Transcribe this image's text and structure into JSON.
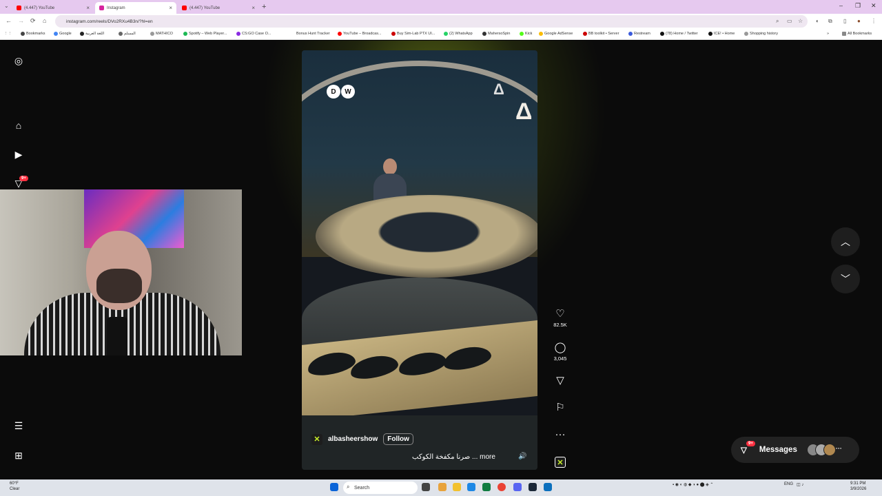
{
  "browser": {
    "tabs": [
      {
        "label": "(4.447) YouTube",
        "active": false,
        "favicon_color": "#ff0000"
      },
      {
        "label": "Instagram",
        "active": true,
        "favicon_color": "#d6249f"
      },
      {
        "label": "(4.447) YouTube",
        "active": false,
        "favicon_color": "#ff0000"
      }
    ],
    "url": "instagram.com/reels/DVo2RXu4B3n/?hl=en",
    "bookmarks": [
      "Bookmarks",
      "Google",
      "اللغة العربية",
      "المسلم",
      "MATHICO",
      "Spotify – Web Player...",
      "CS:GO Case O...",
      "Bonus Hunt Tracker",
      "YouTube – Broadcas...",
      "Buy Sim-Lab PTX UI...",
      "(2) WhatsApp",
      "MahersoSpin",
      "Kick",
      "Google AdSense",
      "BB toolkit • Server",
      "Restream",
      "(78) Home / Twitter",
      "ICE! • Home",
      "Shopping history"
    ],
    "all_bookmarks": "All Bookmarks"
  },
  "sidebar": {
    "notifications_badge": "9+"
  },
  "reel": {
    "author": "albasheershow",
    "follow_label": "Follow",
    "caption": "صرنا مكفخة الكوكب ... more",
    "likes": "82.5K",
    "comments": "3,045"
  },
  "messages": {
    "label": "Messages",
    "badge": "9+"
  },
  "taskbar": {
    "search": "Search",
    "weather_temp": "60°F",
    "weather_desc": "Clear",
    "lang": "ENG",
    "time": "9:31 PM",
    "date": "3/9/2026"
  },
  "colors": {
    "accent_glow": "#aac81e",
    "badge_red": "#ff3040",
    "tab_bar": "#e6c9ef"
  }
}
